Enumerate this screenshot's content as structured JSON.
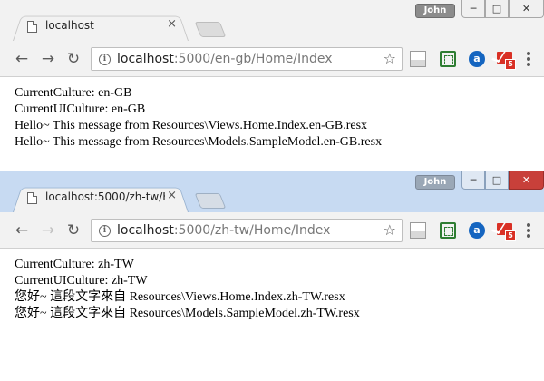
{
  "user_badge": "John",
  "window_controls": {
    "minimize": "─",
    "maximize": "□",
    "close": "✕"
  },
  "windows": [
    {
      "tab_title": "localhost",
      "url_host": "localhost",
      "url_path": ":5000/en-gb/Home/Index",
      "forward_enabled": true,
      "lines": [
        "CurrentCulture: en-GB",
        "CurrentUICulture: en-GB",
        "Hello~ This message from Resources\\Views.Home.Index.en-GB.resx",
        "Hello~ This message from Resources\\Models.SampleModel.en-GB.resx"
      ]
    },
    {
      "tab_title": "localhost:5000/zh-tw/H",
      "url_host": "localhost",
      "url_path": ":5000/zh-tw/Home/Index",
      "forward_enabled": false,
      "lines": [
        "CurrentCulture: zh-TW",
        "CurrentUICulture: zh-TW",
        "您好~ 這段文字來自 Resources\\Views.Home.Index.zh-TW.resx",
        "您好~ 這段文字來自 Resources\\Models.SampleModel.zh-TW.resx"
      ]
    }
  ],
  "icons": {
    "back": "←",
    "forward": "→",
    "reload": "↻",
    "star": "☆",
    "info": "i",
    "close_tab": "×",
    "extension_a": "a",
    "mail_count": "5"
  },
  "colors": {
    "active_titlebar": "#c7daf2",
    "inactive_titlebar": "#f2f2f2",
    "close_button": "#c8403a"
  }
}
